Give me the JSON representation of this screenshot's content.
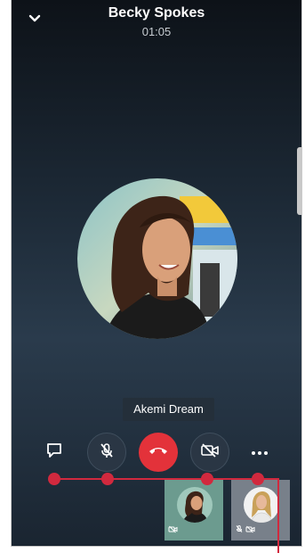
{
  "header": {
    "caller_name": "Becky Spokes",
    "call_duration": "01:05"
  },
  "participant": {
    "name_label": "Akemi Dream"
  },
  "controls": {
    "chat_icon": "chat-bubble-icon",
    "mute_icon": "mic-off-icon",
    "end_call_icon": "phone-hangup-icon",
    "video_icon": "video-off-icon",
    "more_icon": "more-horizontal-icon"
  },
  "thumbnails": [
    {
      "status_icons": [
        "video-off-icon"
      ]
    },
    {
      "status_icons": [
        "mic-off-icon",
        "video-off-icon"
      ]
    }
  ],
  "colors": {
    "end_call": "#e3323a",
    "annotation": "#d1293e",
    "control_bg": "#2a3644"
  }
}
